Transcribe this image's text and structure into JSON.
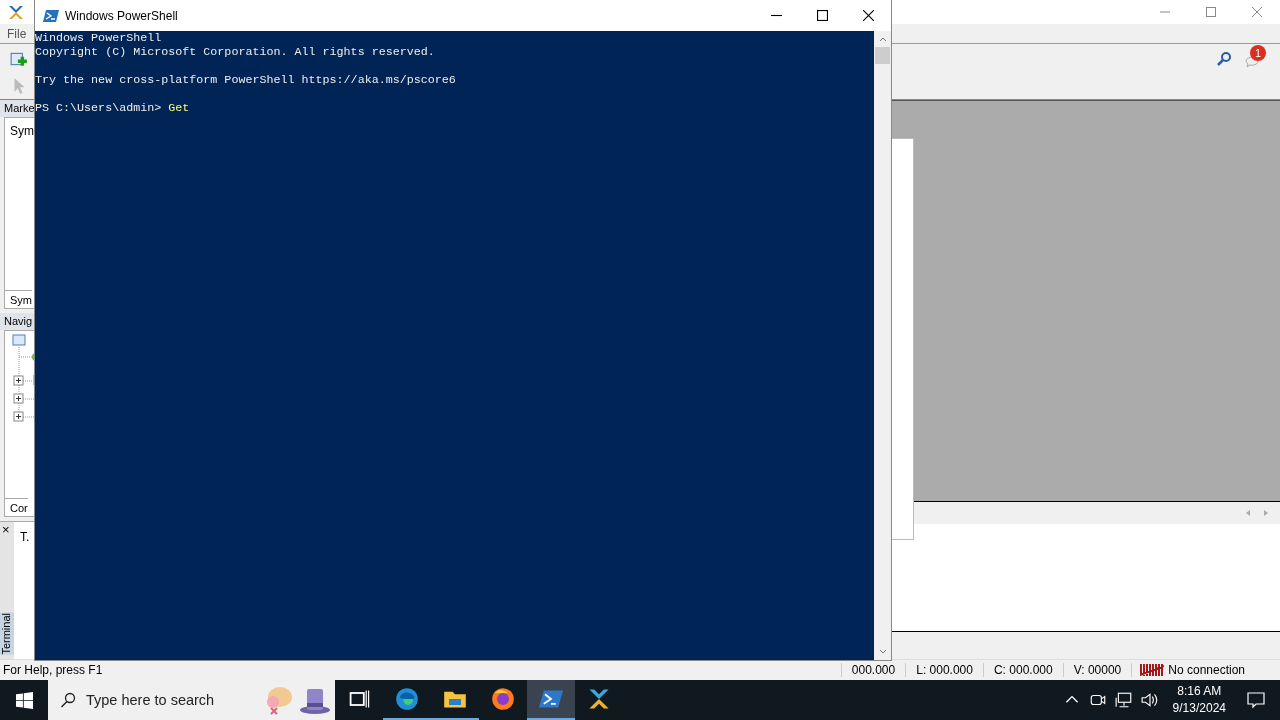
{
  "background_app": {
    "menu": [
      "File"
    ],
    "panels": {
      "markers_header": "Marke",
      "symbols_label": "Sym",
      "symbols_tab": "Sym",
      "navigator_header": "Navig",
      "navigator_tab": "Cor",
      "terminal_close": "×",
      "terminal_item": "T.",
      "terminal_tab": "Terminal"
    },
    "notification_count": "1",
    "status_bar": {
      "help": "For Help, press F1",
      "fields": [
        "000.000",
        "L: 000.000",
        "C: 000.000",
        "V: 00000"
      ],
      "connection": "No connection"
    }
  },
  "powershell": {
    "title": "Windows PowerShell",
    "blocks": [
      [
        "Windows PowerShell",
        "Copyright (C) Microsoft Corporation. All rights reserved."
      ],
      [
        "Try the new cross-platform PowerShell https://aka.ms/pscore6"
      ]
    ],
    "prompt": "PS C:\\Users\\admin> ",
    "command": "Get"
  },
  "taskbar": {
    "search_placeholder": "Type here to search",
    "apps": [
      {
        "kind": "taskview",
        "running": false,
        "selected": false
      },
      {
        "kind": "edge",
        "running": true,
        "selected": false
      },
      {
        "kind": "explorer",
        "running": true,
        "selected": false
      },
      {
        "kind": "firefox",
        "running": false,
        "selected": false
      },
      {
        "kind": "powershell",
        "running": true,
        "selected": true
      },
      {
        "kind": "app",
        "running": false,
        "selected": false
      }
    ],
    "time": "8:16 AM",
    "date": "9/13/2024"
  }
}
